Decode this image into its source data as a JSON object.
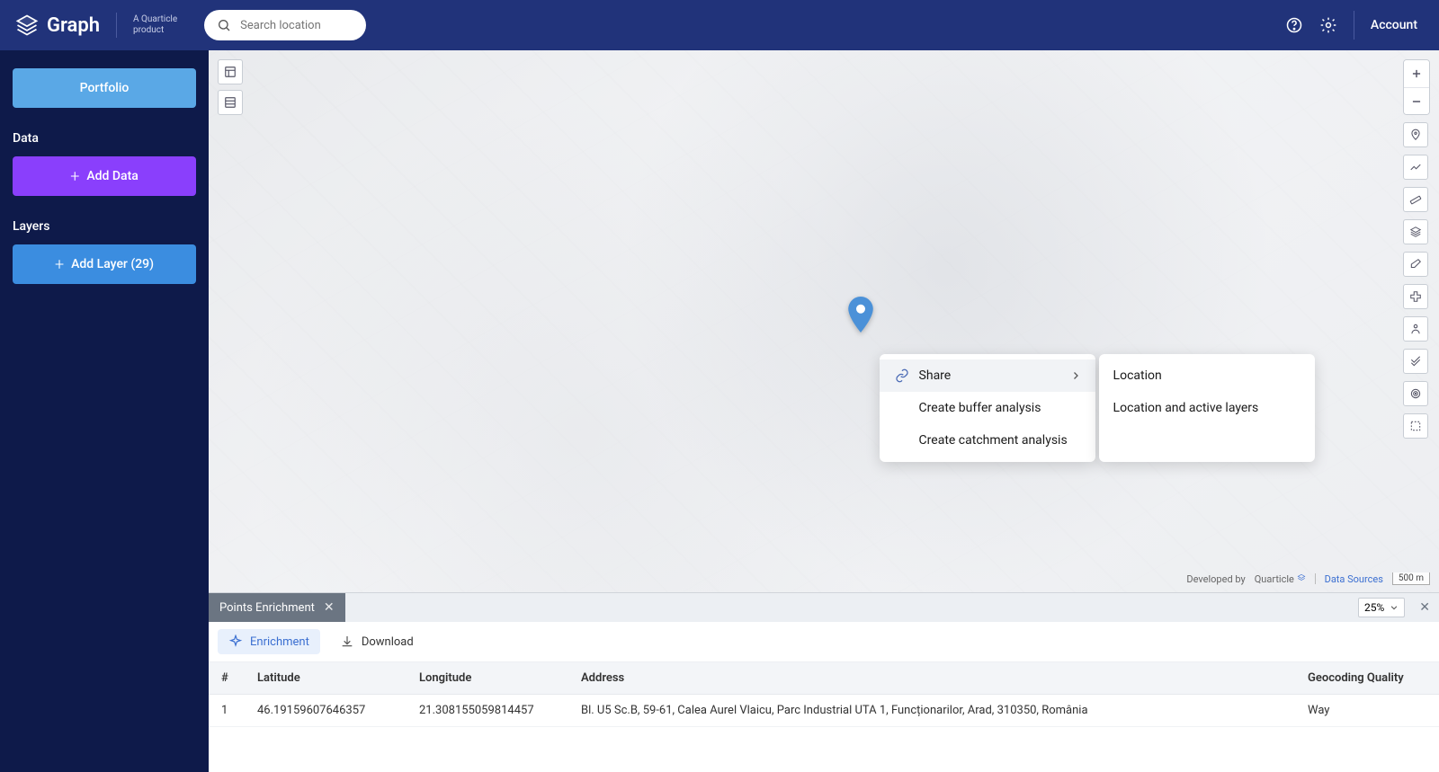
{
  "header": {
    "brand": "Graph",
    "subline1": "A Quarticle",
    "subline2": "product",
    "search_placeholder": "Search location",
    "account_label": "Account"
  },
  "sidebar": {
    "portfolio_label": "Portfolio",
    "data_title": "Data",
    "add_data_label": "Add Data",
    "layers_title": "Layers",
    "add_layer_label": "Add Layer (29)"
  },
  "context_menu": {
    "share": "Share",
    "create_buffer": "Create buffer analysis",
    "create_catchment": "Create catchment analysis",
    "sub_location": "Location",
    "sub_location_layers": "Location and active layers"
  },
  "attribution": {
    "dev_by": "Developed by",
    "quarticle": "Quarticle",
    "data_sources": "Data Sources",
    "scale": "500 m"
  },
  "panel": {
    "tab_title": "Points Enrichment",
    "zoom": "25%",
    "enrichment_label": "Enrichment",
    "download_label": "Download",
    "columns": {
      "idx": "#",
      "lat": "Latitude",
      "lon": "Longitude",
      "addr": "Address",
      "quality": "Geocoding Quality"
    },
    "rows": [
      {
        "idx": "1",
        "lat": "46.19159607646357",
        "lon": "21.308155059814457",
        "addr": "Bl. U5 Sc.B, 59-61, Calea Aurel Vlaicu, Parc Industrial UTA 1, Funcționarilor, Arad, 310350, România",
        "quality": "Way"
      }
    ]
  }
}
